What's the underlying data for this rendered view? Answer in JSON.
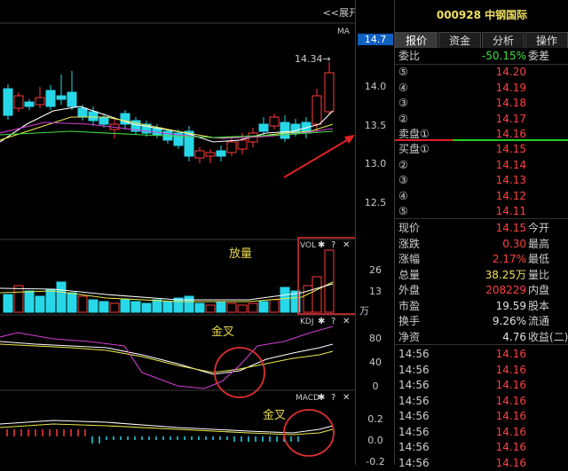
{
  "topbar": {
    "expand_label": "<<展开",
    "ma_label": "MA",
    "price_tag": "14.7"
  },
  "price_axis": [
    "14.0",
    "13.5",
    "13.0",
    "12.5"
  ],
  "annotations": {
    "high": "14.34→",
    "volume_note": "放量",
    "golden_cross_kdj": "金叉",
    "golden_cross_macd": "金叉"
  },
  "vol": {
    "title": "VOL",
    "axis": [
      "26",
      "13"
    ],
    "unit": "万"
  },
  "kdj": {
    "title": "KDJ",
    "axis": [
      "80",
      "40",
      "0"
    ]
  },
  "macd": {
    "title": "MACD",
    "axis": [
      "0.2",
      "0.0",
      "-0.2"
    ]
  },
  "panel": {
    "code_title": "000928 中钢国际",
    "tabs": [
      "报价",
      "资金",
      "分析",
      "操作"
    ],
    "weibi": {
      "label": "委比",
      "value": "-50.15%",
      "tail": "委差"
    },
    "sell": [
      {
        "label": "⑤",
        "price": "14.20"
      },
      {
        "label": "④",
        "price": "14.19"
      },
      {
        "label": "③",
        "price": "14.18"
      },
      {
        "label": "②",
        "price": "14.17"
      },
      {
        "label": "卖盘①",
        "price": "14.16"
      }
    ],
    "buy": [
      {
        "label": "买盘①",
        "price": "14.15"
      },
      {
        "label": "②",
        "price": "14.14"
      },
      {
        "label": "③",
        "price": "14.13"
      },
      {
        "label": "④",
        "price": "14.12"
      },
      {
        "label": "⑤",
        "price": "14.11"
      }
    ],
    "stats": [
      {
        "label": "现价",
        "value": "14.15",
        "tail": "今开"
      },
      {
        "label": "涨跌",
        "value": "0.30",
        "tail": "最高"
      },
      {
        "label": "涨幅",
        "value": "2.17%",
        "tail": "最低"
      },
      {
        "label": "总量",
        "value": "38.25万",
        "tail": "量比"
      },
      {
        "label": "外盘",
        "value": "208229",
        "tail": "内盘"
      },
      {
        "label": "市盈",
        "value": "19.59",
        "tail": "股本"
      },
      {
        "label": "换手",
        "value": "9.26%",
        "tail": "流通"
      },
      {
        "label": "净资",
        "value": "4.76",
        "tail": "收益(二)"
      }
    ],
    "ticks": [
      {
        "time": "14:56",
        "price": "14.16"
      },
      {
        "time": "14:56",
        "price": "14.16"
      },
      {
        "time": "14:56",
        "price": "14.16"
      },
      {
        "time": "14:56",
        "price": "14.16"
      },
      {
        "time": "14:56",
        "price": "14.16"
      },
      {
        "time": "14:56",
        "price": "14.16"
      },
      {
        "time": "14:56",
        "price": "14.16"
      },
      {
        "time": "14:56",
        "price": "14.16"
      }
    ]
  },
  "colors": {
    "up": "#ff3b3b",
    "down": "#27d7e8",
    "ma5": "#ffffff",
    "ma10": "#e8e84a",
    "ma20": "#d040d0",
    "ma30": "#40e040",
    "arrow": "#e02020",
    "circle": "#e03030"
  }
}
